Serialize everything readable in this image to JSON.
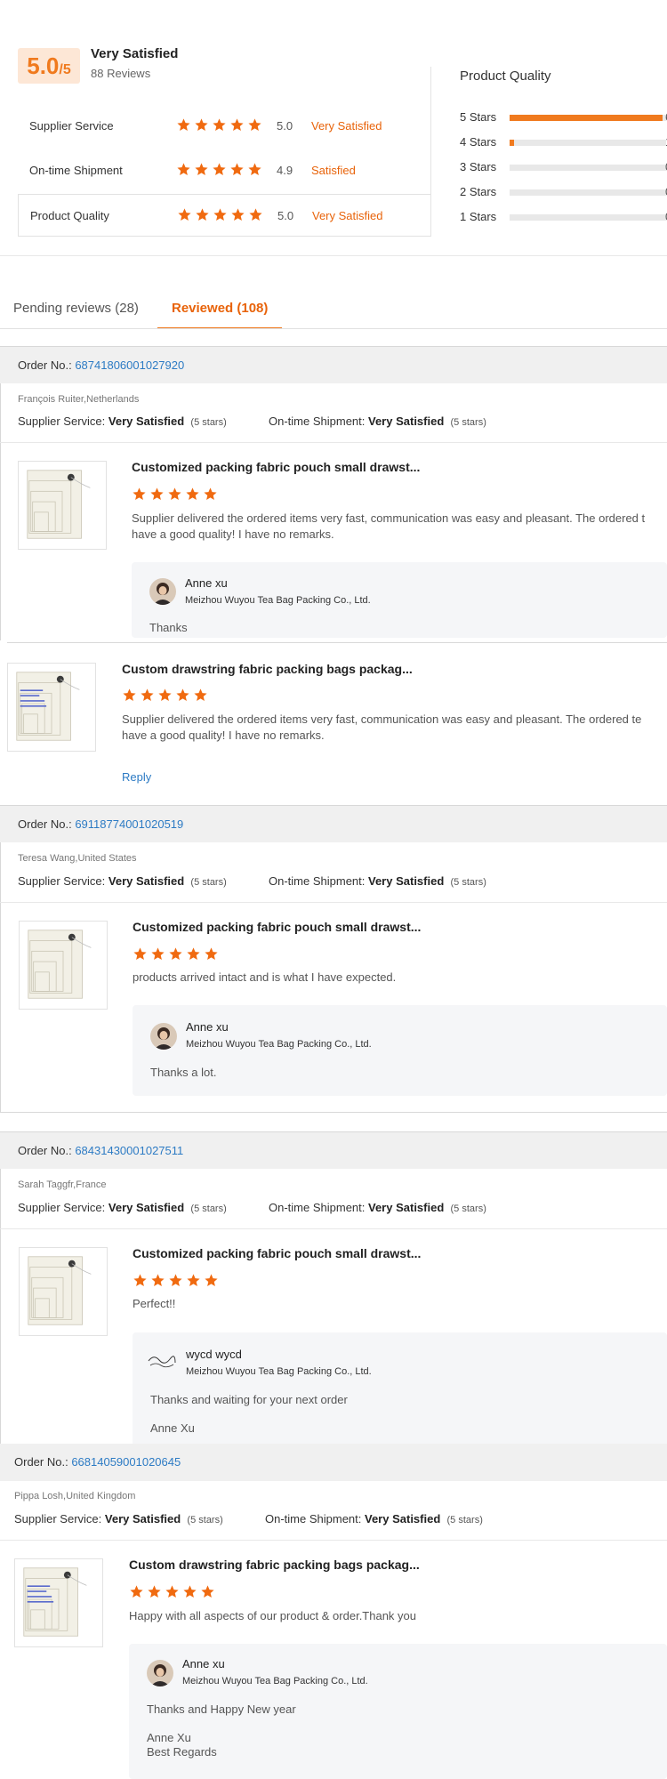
{
  "summary": {
    "score": "5.0",
    "score_suffix": "/5",
    "title": "Very Satisfied",
    "reviews": "88 Reviews",
    "metrics": [
      {
        "label": "Supplier Service",
        "stars": 5,
        "value": "5.0",
        "text": "Very Satisfied"
      },
      {
        "label": "On-time Shipment",
        "stars": 5,
        "value": "4.9",
        "text": "Satisfied"
      },
      {
        "label": "Product Quality",
        "stars": 5,
        "value": "5.0",
        "text": "Very Satisfied"
      }
    ],
    "quality_title": "Product Quality",
    "bars": [
      {
        "label": "5 Stars",
        "fraction": 0.98
      },
      {
        "label": "4 Stars",
        "fraction": 0.03
      },
      {
        "label": "3 Stars",
        "fraction": 0
      },
      {
        "label": "2 Stars",
        "fraction": 0
      },
      {
        "label": "1 Stars",
        "fraction": 0
      }
    ]
  },
  "tabs": {
    "pending": "Pending reviews (28)",
    "reviewed": "Reviewed (108)"
  },
  "labels": {
    "order_no": "Order No.:",
    "supplier_service": "Supplier Service:",
    "ontime_shipment": "On-time Shipment:",
    "five_stars": "(5 stars)",
    "reply": "Reply"
  },
  "colors": {
    "accent": "#f07a1e",
    "link": "#2d7bc4",
    "star": "#f06a10"
  },
  "orders": [
    {
      "order_no": "68741806001027920",
      "buyer": "François Ruiter,Netherlands",
      "supplier_service": "Very Satisfied",
      "ontime_shipment": "Very Satisfied",
      "items": [
        {
          "title": "Customized packing fabric pouch small drawst...",
          "stars": 5,
          "review": [
            "Supplier delivered the ordered items very fast, communication was easy and pleasant. The ordered t",
            "have a good quality! I have no remarks."
          ],
          "reply": {
            "name": "Anne xu",
            "company": "Meizhou Wuyou Tea Bag Packing Co., Ltd.",
            "message": [
              "Thanks"
            ]
          }
        },
        {
          "title": "Custom drawstring fabric packing bags packag...",
          "stars": 5,
          "review": [
            "Supplier delivered the ordered items very fast, communication was easy and pleasant. The ordered te",
            "have a good quality! I have no remarks."
          ],
          "reply_link": "Reply"
        }
      ]
    },
    {
      "order_no": "69118774001020519",
      "buyer": "Teresa Wang,United States",
      "supplier_service": "Very Satisfied",
      "ontime_shipment": "Very Satisfied",
      "items": [
        {
          "title": "Customized packing fabric pouch small drawst...",
          "stars": 5,
          "review": [
            "products arrived intact and is what I have expected."
          ],
          "reply": {
            "name": "Anne xu",
            "company": "Meizhou Wuyou Tea Bag Packing Co., Ltd.",
            "message": [
              "Thanks a lot."
            ]
          }
        }
      ]
    },
    {
      "order_no": "68431430001027511",
      "buyer": "Sarah Taggfr,France",
      "supplier_service": "Very Satisfied",
      "ontime_shipment": "Very Satisfied",
      "items": [
        {
          "title": "Customized packing fabric pouch small drawst...",
          "stars": 5,
          "review": [
            "Perfect!!"
          ],
          "reply": {
            "name": "wycd wycd",
            "company": "Meizhou Wuyou Tea Bag Packing Co., Ltd.",
            "message": [
              "Thanks and waiting for your next order",
              "",
              "Anne Xu"
            ]
          }
        }
      ]
    },
    {
      "order_no": "66814059001020645",
      "buyer": "Pippa Losh,United Kingdom",
      "supplier_service": "Very Satisfied",
      "ontime_shipment": "Very Satisfied",
      "items": [
        {
          "title": "Custom drawstring fabric packing bags packag...",
          "stars": 5,
          "review": [
            "Happy with all aspects of our product & order.Thank you"
          ],
          "reply": {
            "name": "Anne xu",
            "company": "Meizhou Wuyou Tea Bag Packing Co., Ltd.",
            "message": [
              "Thanks and Happy New year",
              "",
              "Anne Xu",
              "Best Regards"
            ]
          }
        }
      ]
    }
  ]
}
